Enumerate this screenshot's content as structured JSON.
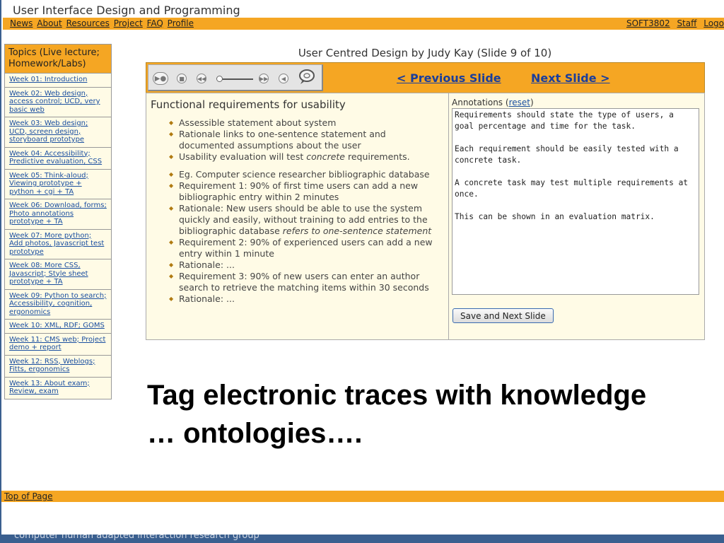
{
  "site": {
    "title": "User Interface Design and Programming"
  },
  "nav": {
    "left": [
      "News",
      "About",
      "Resources",
      "Project",
      "FAQ",
      "Profile"
    ],
    "right": [
      "SOFT3802",
      "Staff",
      "Logo"
    ]
  },
  "sidebar": {
    "header": "Topics (Live lecture; Homework/Labs)",
    "items": [
      "Week 01: Introduction",
      "Week 02: Web design, access control; UCD, very basic web",
      "Week 03: Web design; UCD, screen design, storyboard prototype",
      "Week 04: Accessibility; Predictive evaluation, CSS",
      "Week 05: Think-aloud; Viewing prototype + python + cgi + TA",
      "Week 06: Download, forms; Photo annotations prototype + TA",
      "Week 07: More python; Add photos, Javascript test prototype",
      "Week 08: More CSS, Javascript; Style sheet prototype + TA",
      "Week 09: Python to search; Accessibility, cognition, ergonomics",
      "Week 10: XML, RDF; GOMS",
      "Week 11: CMS web; Project demo + report",
      "Week 12: RSS, Weblogs; Fitts, ergonomics",
      "Week 13: About exam; Review, exam"
    ]
  },
  "slide": {
    "title": "User Centred Design by Judy Kay (Slide 9 of 10)",
    "prev_label": "< Previous Slide",
    "next_label": "Next Slide >",
    "heading": "Functional requirements for usability",
    "b1": "Assessible statement about system",
    "b2": "Rationale links to one-sentence statement and documented assumptions about the user",
    "b3_pre": "Usability evaluation will test ",
    "b3_em": "concrete",
    "b3_post": " requirements.",
    "b4": "Eg. Computer science researcher bibliographic database",
    "b5": "Requirement 1: 90% of first time users can add a new bibliographic entry within 2 minutes",
    "b6_pre": "Rationale: New users should be able to use the system quickly and easily, without training to add entries to the bibliographic database ",
    "b6_em": "refers to one-sentence statement",
    "b7": "Requirement 2: 90% of experienced users can add a new entry within 1 minute",
    "b8": "Rationale: ...",
    "b9": "Requirement 3: 90% of new users can enter an author search to retrieve the matching items within 30 seconds",
    "b10": "Rationale: ..."
  },
  "annotations": {
    "label_pre": "Annotations (",
    "reset": "reset",
    "label_post": ")",
    "text": "Requirements should state the type of users, a goal percentage and time for the task.\n\nEach requirement should be easily tested with a concrete task.\n\nA concrete task may test multiple requirements at once.\n\nThis can be shown in an evaluation matrix.",
    "save_label": "Save and Next Slide"
  },
  "overlay": {
    "line1": "Tag electronic traces with knowledge",
    "line2": "… ontologies…."
  },
  "bottom": {
    "top_link": "Top of Page"
  },
  "footer": {
    "text": "computer human adapted interaction research group"
  },
  "colors": {
    "accent": "#f5a623",
    "panel_bg": "#fffbe6",
    "link": "#1a4fa0",
    "footer_bg": "#3a5f8f"
  },
  "icons": [
    "play-icon",
    "stop-icon",
    "rewind-icon",
    "forward-icon",
    "volume-icon",
    "speech-bubble-icon"
  ]
}
